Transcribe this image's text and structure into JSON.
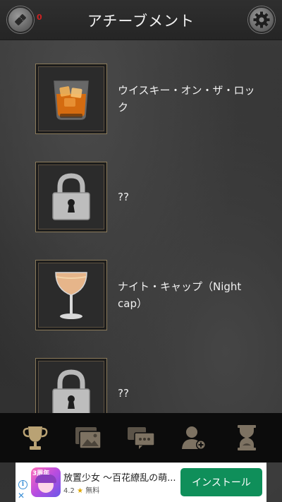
{
  "header": {
    "title": "アチーブメント",
    "ticket_count": "0",
    "left_icon": "ticket-icon",
    "right_icon": "gear-icon"
  },
  "achievements": [
    {
      "label": "ウイスキー・オン・ザ・ロック",
      "icon": "whiskey-on-the-rocks-icon",
      "locked": false
    },
    {
      "label": "??",
      "icon": "padlock-icon",
      "locked": true
    },
    {
      "label": "ナイト・キャップ（Night cap）",
      "icon": "cocktail-glass-icon",
      "locked": false
    },
    {
      "label": "??",
      "icon": "padlock-icon",
      "locked": true
    }
  ],
  "bottom_nav": [
    "trophy-icon",
    "gallery-icon",
    "messages-icon",
    "add-person-icon",
    "hourglass-icon"
  ],
  "ad": {
    "title": "放置少女 〜百花繚乱の萌...",
    "rating": "4.2",
    "price": "無料",
    "install_label": "インストール",
    "icon_badge": "3周年"
  },
  "colors": {
    "gold": "#b9a274",
    "install_green": "#0f8f5a",
    "frame_border": "#8a7a5a"
  }
}
